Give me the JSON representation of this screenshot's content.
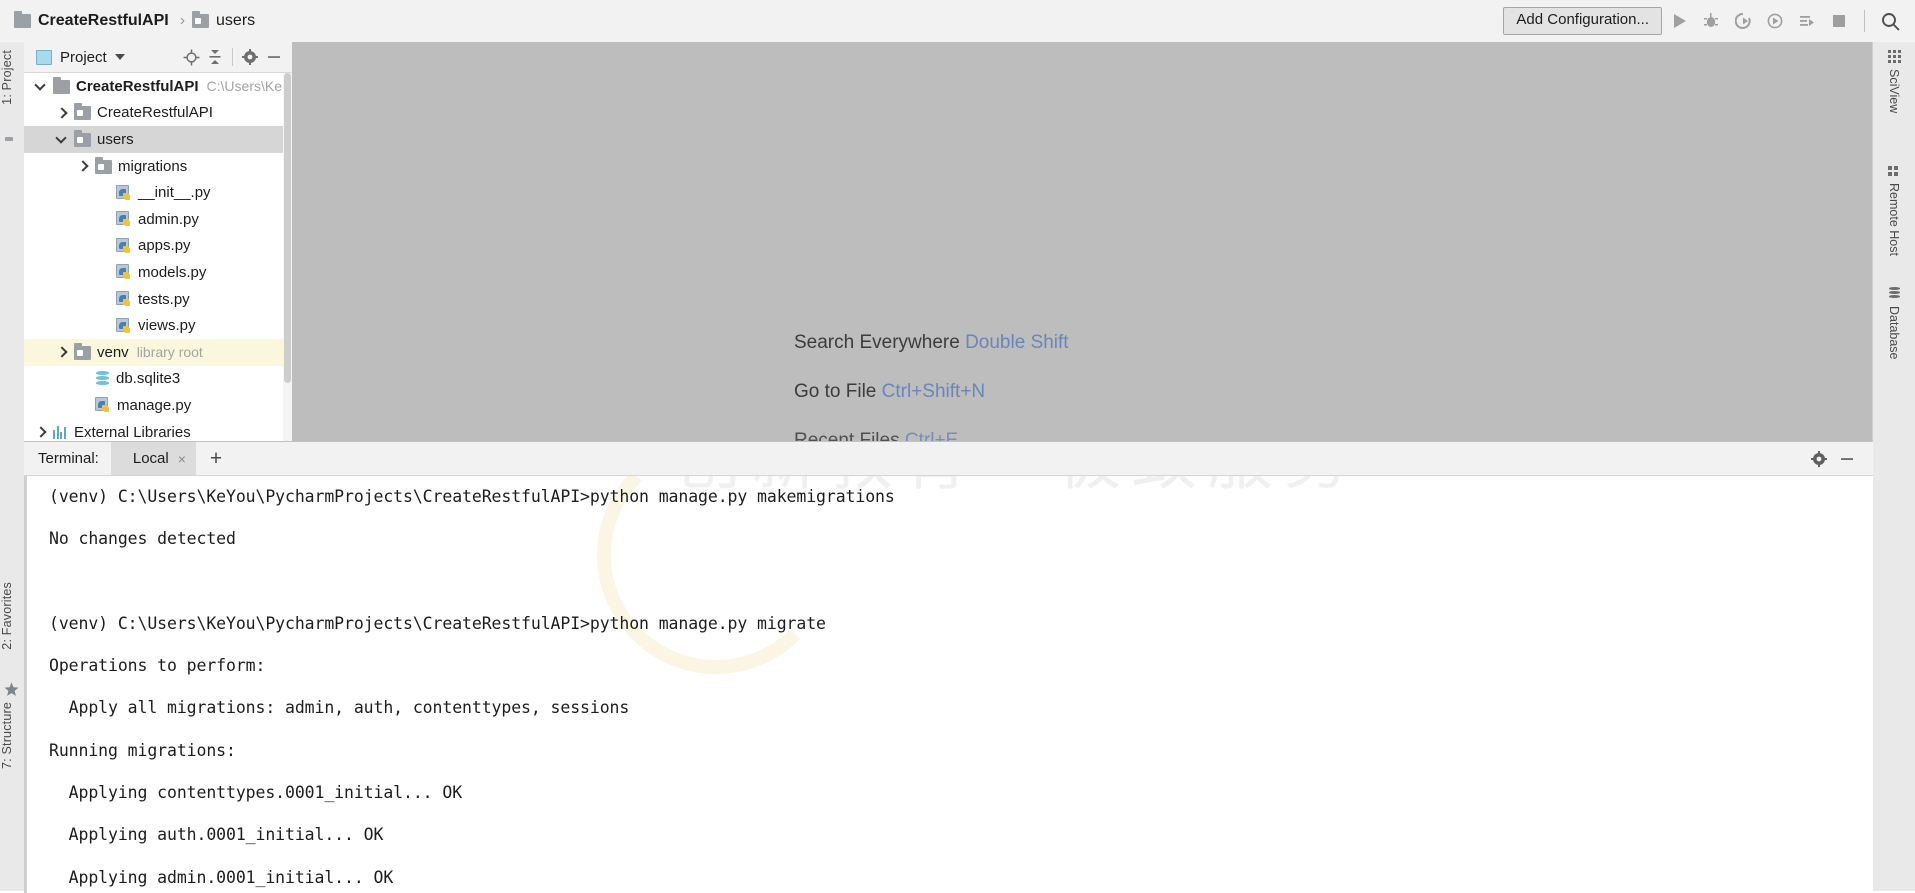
{
  "topbar": {
    "breadcrumb": [
      {
        "label": "CreateRestfulAPI",
        "icon": "folder-icon"
      },
      {
        "label": "users",
        "icon": "package-folder-icon"
      }
    ],
    "separator": "›",
    "add_configuration": "Add Configuration...",
    "icons": [
      "run-icon",
      "debug-icon",
      "run-with-coverage-icon",
      "profile-icon",
      "run-anything-icon",
      "stop-icon",
      "search-icon"
    ]
  },
  "left_strip": {
    "tabs": [
      {
        "label": "1: Project",
        "icon": "project-folder-icon"
      },
      {
        "label": "2: Favorites",
        "icon": "star-icon"
      },
      {
        "label": "7: Structure",
        "icon": "structure-icon"
      }
    ]
  },
  "project_panel": {
    "title": "Project",
    "icons": [
      "project-select-icon",
      "locate-icon",
      "collapse-all-icon",
      "gear-icon",
      "hide-icon"
    ],
    "tree": [
      {
        "label": "CreateRestfulAPI",
        "sub": "C:\\Users\\Ke",
        "indent": 0,
        "arrow": "down",
        "icon": "folder-icon",
        "bold": true,
        "state": "none"
      },
      {
        "label": "CreateRestfulAPI",
        "sub": "",
        "indent": 1,
        "arrow": "right",
        "icon": "package-folder-icon",
        "bold": false,
        "state": "none"
      },
      {
        "label": "users",
        "sub": "",
        "indent": 1,
        "arrow": "down",
        "icon": "package-folder-icon",
        "bold": false,
        "state": "selected"
      },
      {
        "label": "migrations",
        "sub": "",
        "indent": 2,
        "arrow": "right",
        "icon": "package-folder-icon",
        "bold": false,
        "state": "none"
      },
      {
        "label": "__init__.py",
        "sub": "",
        "indent": 3,
        "arrow": "none",
        "icon": "python-file-icon",
        "bold": false,
        "state": "none"
      },
      {
        "label": "admin.py",
        "sub": "",
        "indent": 3,
        "arrow": "none",
        "icon": "python-file-icon",
        "bold": false,
        "state": "none"
      },
      {
        "label": "apps.py",
        "sub": "",
        "indent": 3,
        "arrow": "none",
        "icon": "python-file-icon",
        "bold": false,
        "state": "none"
      },
      {
        "label": "models.py",
        "sub": "",
        "indent": 3,
        "arrow": "none",
        "icon": "python-file-icon",
        "bold": false,
        "state": "none"
      },
      {
        "label": "tests.py",
        "sub": "",
        "indent": 3,
        "arrow": "none",
        "icon": "python-file-icon",
        "bold": false,
        "state": "none"
      },
      {
        "label": "views.py",
        "sub": "",
        "indent": 3,
        "arrow": "none",
        "icon": "python-file-icon",
        "bold": false,
        "state": "none"
      },
      {
        "label": "venv",
        "sub": "library root",
        "indent": 1,
        "arrow": "right",
        "icon": "package-folder-icon",
        "bold": false,
        "state": "highlight"
      },
      {
        "label": "db.sqlite3",
        "sub": "",
        "indent": 2,
        "arrow": "none",
        "icon": "database-file-icon",
        "bold": false,
        "state": "none"
      },
      {
        "label": "manage.py",
        "sub": "",
        "indent": 2,
        "arrow": "none",
        "icon": "python-file-icon",
        "bold": false,
        "state": "none"
      },
      {
        "label": "External Libraries",
        "sub": "",
        "indent": 0,
        "arrow": "right",
        "icon": "libraries-icon",
        "bold": false,
        "state": "none"
      }
    ]
  },
  "editor": {
    "hints": [
      {
        "action": "Search Everywhere",
        "shortcut": "Double Shift"
      },
      {
        "action": "Go to File",
        "shortcut": "Ctrl+Shift+N"
      },
      {
        "action": "Recent Files",
        "shortcut": "Ctrl+E"
      }
    ]
  },
  "right_strip": {
    "tabs": [
      {
        "label": "SciView",
        "icon": "sciview-grid-icon"
      },
      {
        "label": "Remote Host",
        "icon": "remote-host-icon"
      },
      {
        "label": "Database",
        "icon": "database-icon"
      }
    ]
  },
  "terminal": {
    "label": "Terminal:",
    "tab": "Local",
    "close": "×",
    "add": "+",
    "icons": [
      "gear-icon",
      "hide-icon"
    ],
    "watermark_line1": "创新教育　极致服务",
    "lines": [
      "(venv) C:\\Users\\KeYou\\PycharmProjects\\CreateRestfulAPI>python manage.py makemigrations",
      "No changes detected",
      "",
      "(venv) C:\\Users\\KeYou\\PycharmProjects\\CreateRestfulAPI>python manage.py migrate",
      "Operations to perform:",
      "  Apply all migrations: admin, auth, contenttypes, sessions",
      "Running migrations:",
      "  Applying contenttypes.0001_initial... OK",
      "  Applying auth.0001_initial... OK",
      "  Applying admin.0001_initial... OK"
    ]
  },
  "colors": {
    "accent_link": "#6b85b8",
    "selection": "#d6d6d6",
    "highlight": "#fbf7dd",
    "editor_bg": "#bdbdbd",
    "chrome": "#f2f2f2"
  }
}
